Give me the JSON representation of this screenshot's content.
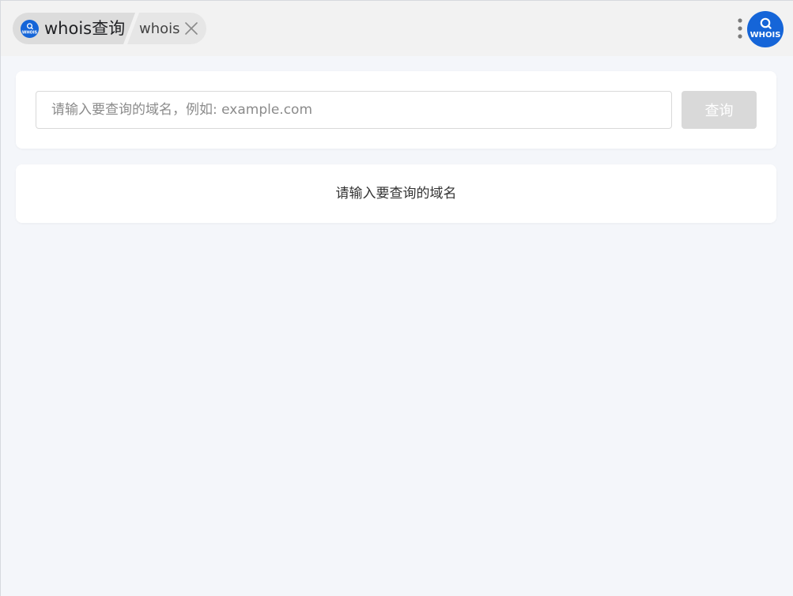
{
  "breadcrumb": {
    "app_name": "whois查询",
    "page_name": "whois"
  },
  "logo": {
    "small_text": "WHOIS",
    "large_text": "WHOIS"
  },
  "search": {
    "placeholder": "请输入要查询的域名，例如: example.com",
    "value": "",
    "button_label": "查询"
  },
  "result": {
    "hint": "请输入要查询的域名"
  },
  "colors": {
    "brand_blue": "#1565d8",
    "disabled_button": "#d9d9d9",
    "page_background": "#f4f6fa"
  },
  "icons": {
    "close": "close-icon",
    "more": "more-vertical-icon",
    "logo": "whois-logo-icon"
  }
}
